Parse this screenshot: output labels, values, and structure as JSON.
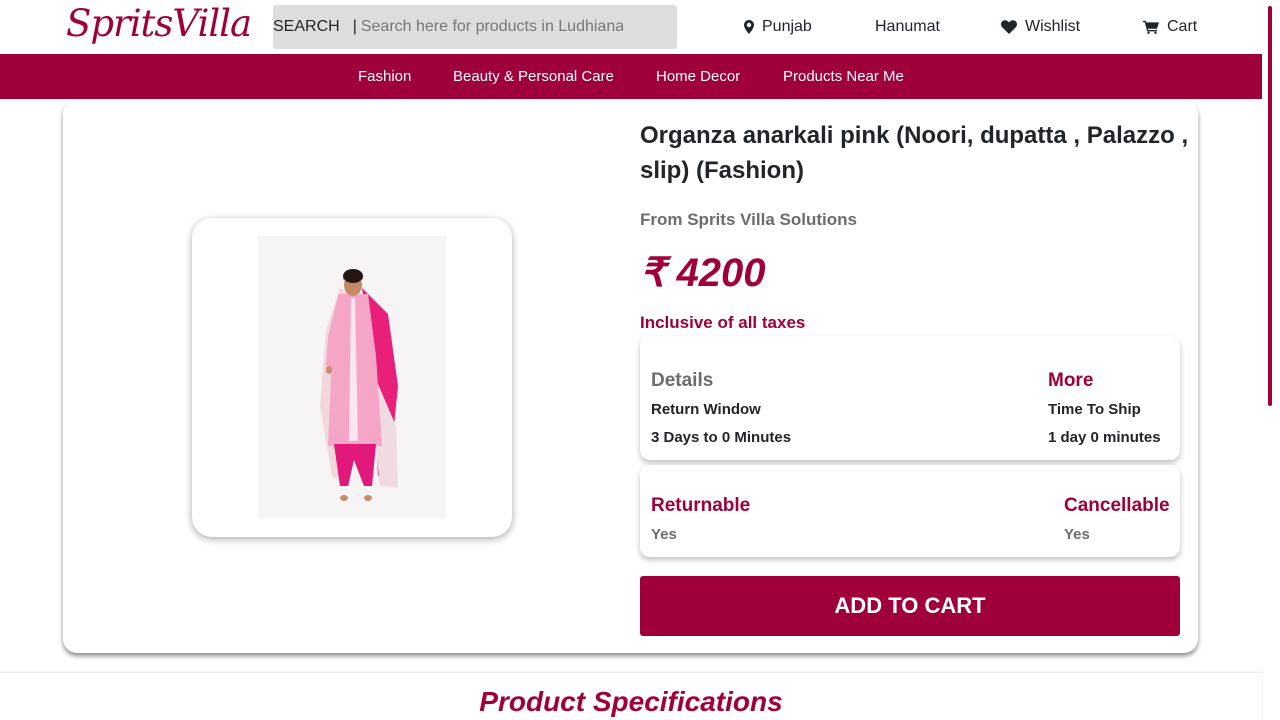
{
  "header": {
    "logo_text": "SpritsVilla",
    "search_label": "SEARCH",
    "search_separator": "|",
    "search_placeholder": "Search here for products in Ludhiana (P",
    "location": "Punjab",
    "user": "Hanumat",
    "wishlist": "Wishlist",
    "cart": "Cart",
    "icons": {
      "location": "map-marker-icon",
      "wishlist": "heart-icon",
      "cart": "cart-icon"
    }
  },
  "categories": [
    "Fashion",
    "Beauty & Personal Care",
    "Home Decor",
    "Products Near Me"
  ],
  "product": {
    "title": "Organza anarkali pink (Noori, dupatta , Palazzo , slip) (Fashion)",
    "seller": "From Sprits Villa Solutions",
    "price": "₹ 4200",
    "taxes_note": "Inclusive of all taxes",
    "details": {
      "heading": "Details",
      "label": "Return Window",
      "value": "3 Days to 0 Minutes"
    },
    "more": {
      "heading": "More",
      "label": "Time To Ship",
      "value": "1 day 0 minutes"
    },
    "returnable": {
      "label": "Returnable",
      "value": "Yes"
    },
    "cancellable": {
      "label": "Cancellable",
      "value": "Yes"
    },
    "add_to_cart": "ADD TO CART"
  },
  "specifications_title": "Product Specifications",
  "colors": {
    "brand": "#a0003a",
    "muted": "#6c6c6c"
  }
}
